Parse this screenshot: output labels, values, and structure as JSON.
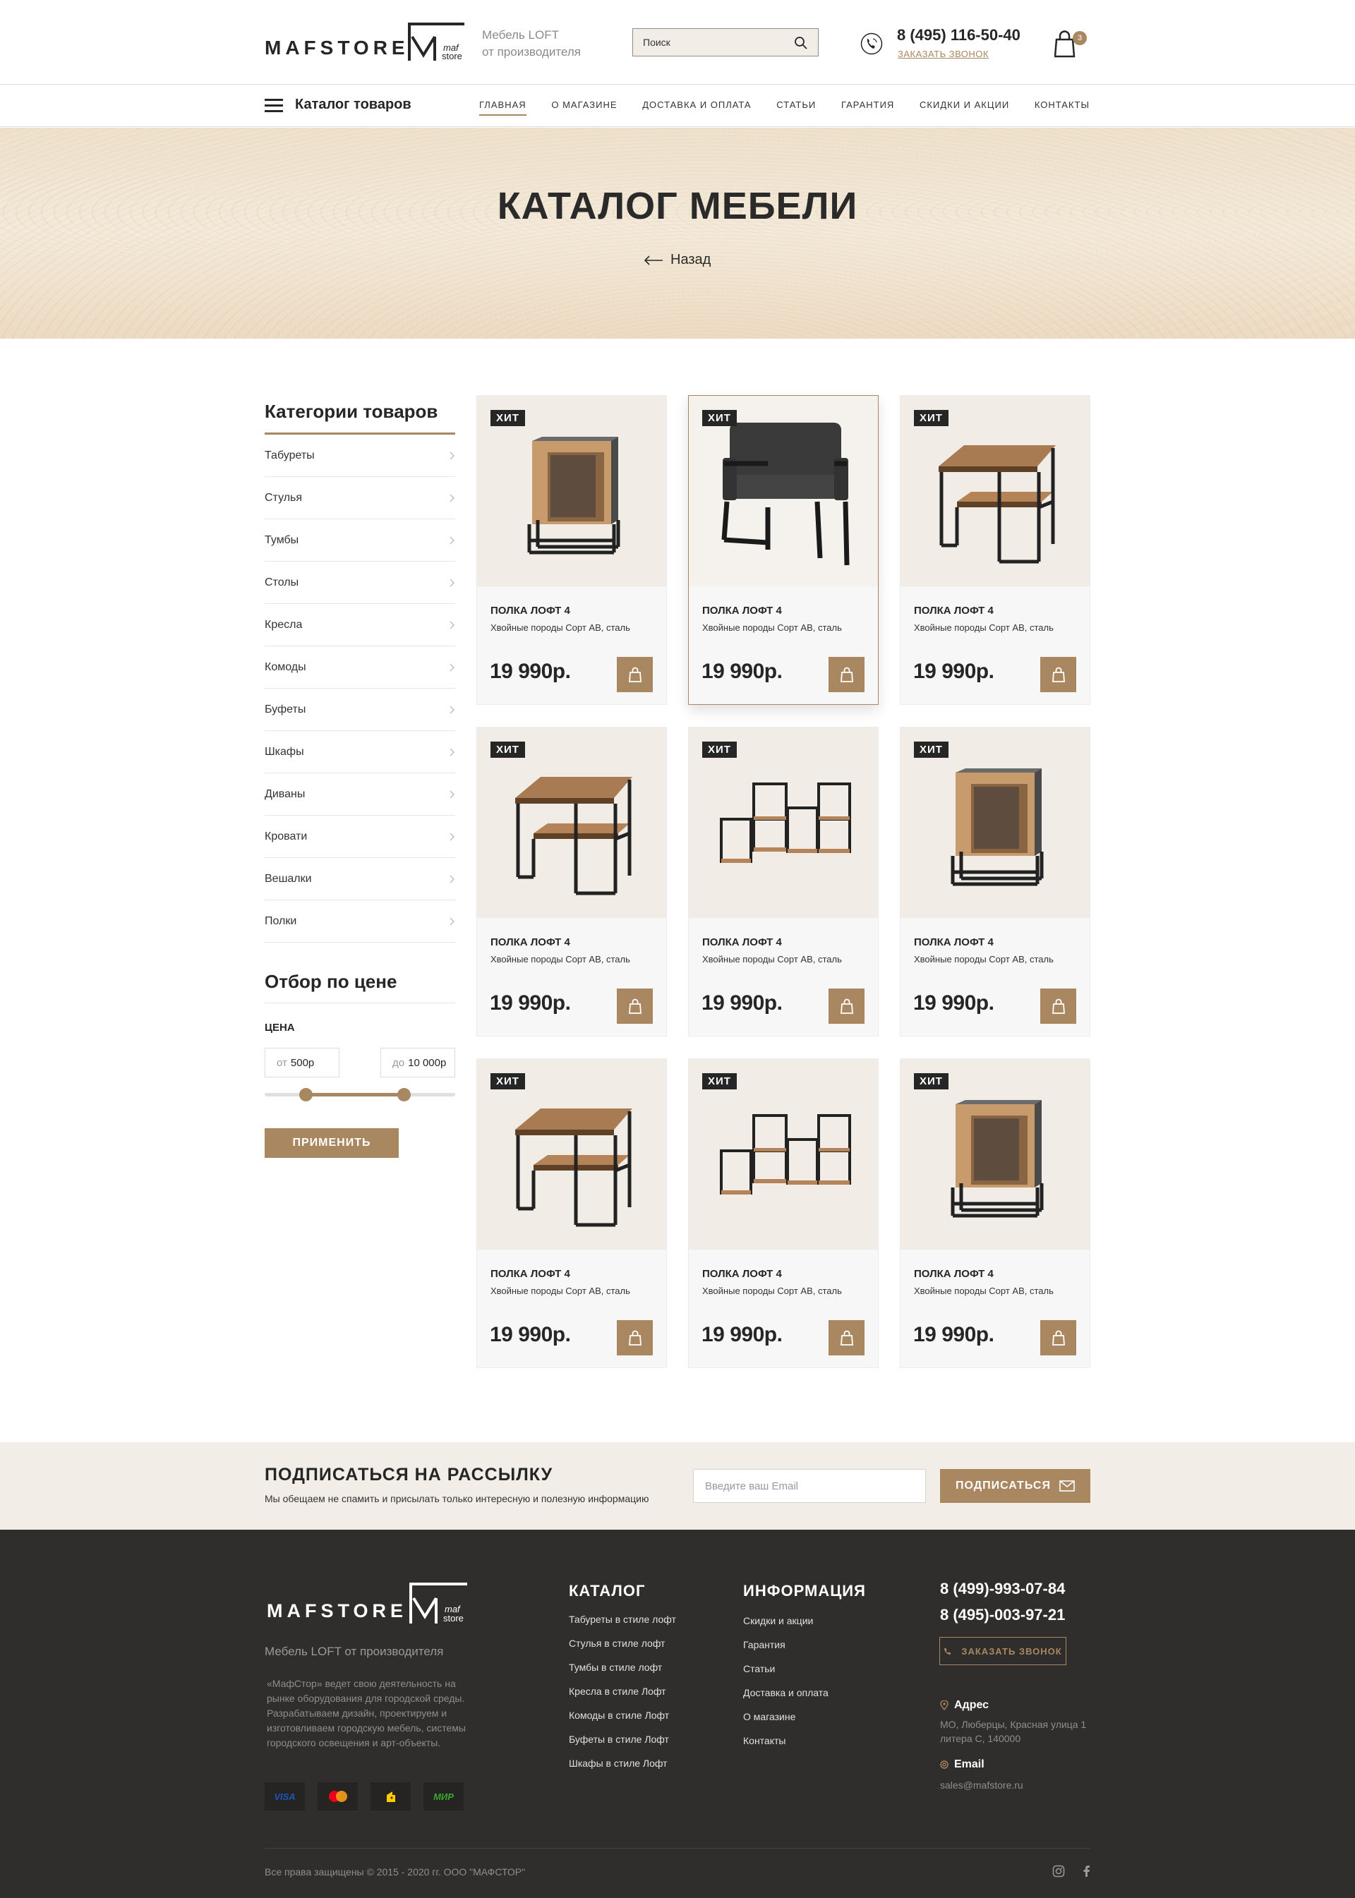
{
  "header": {
    "logo": "MAFSTORE",
    "logo_mark_top": "maf",
    "logo_mark_bottom": "store",
    "tagline_line1": "Мебель LOFT",
    "tagline_line2": "от производителя",
    "search_placeholder": "Поиск",
    "phone": "8 (495) 116-50-40",
    "callback": "ЗАКАЗАТЬ ЗВОНОК",
    "cart_count": "3"
  },
  "nav": {
    "catalog": "Каталог товаров",
    "items": [
      "ГЛАВНАЯ",
      "О МАГАЗИНЕ",
      "ДОСТАВКА И ОПЛАТА",
      "СТАТЬИ",
      "ГАРАНТИЯ",
      "СКИДКИ И АКЦИИ",
      "КОНТАКТЫ"
    ]
  },
  "hero": {
    "title": "КАТАЛОГ МЕБЕЛИ",
    "back": "Назад"
  },
  "sidebar": {
    "categories_title": "Категории товаров",
    "categories": [
      "Табуреты",
      "Стулья",
      "Тумбы",
      "Столы",
      "Кресла",
      "Комоды",
      "Буфеты",
      "Шкафы",
      "Диваны",
      "Кровати",
      "Вешалки",
      "Полки"
    ],
    "price_title": "Отбор по цене",
    "price_label": "ЦЕНА",
    "from_prefix": "от",
    "from_value": "500р",
    "to_prefix": "до",
    "to_value": "10 000р",
    "apply": "ПРИМЕНИТЬ"
  },
  "products": [
    {
      "badge": "ХИТ",
      "name": "ПОЛКА ЛОФТ 4",
      "desc": "Хвойные породы Сорт АВ, сталь",
      "price": "19 990р.",
      "image": "cube-shelf"
    },
    {
      "badge": "ХИТ",
      "name": "ПОЛКА ЛОФТ 4",
      "desc": "Хвойные породы Сорт АВ, сталь",
      "price": "19 990р.",
      "image": "armchair"
    },
    {
      "badge": "ХИТ",
      "name": "ПОЛКА ЛОФТ 4",
      "desc": "Хвойные породы Сорт АВ, сталь",
      "price": "19 990р.",
      "image": "side-table"
    },
    {
      "badge": "ХИТ",
      "name": "ПОЛКА ЛОФТ 4",
      "desc": "Хвойные породы Сорт АВ, сталь",
      "price": "19 990р.",
      "image": "side-table"
    },
    {
      "badge": "ХИТ",
      "name": "ПОЛКА ЛОФТ 4",
      "desc": "Хвойные породы Сорт АВ, сталь",
      "price": "19 990р.",
      "image": "cube-rack"
    },
    {
      "badge": "ХИТ",
      "name": "ПОЛКА ЛОФТ 4",
      "desc": "Хвойные породы Сорт АВ, сталь",
      "price": "19 990р.",
      "image": "cube-shelf"
    },
    {
      "badge": "ХИТ",
      "name": "ПОЛКА ЛОФТ 4",
      "desc": "Хвойные породы Сорт АВ, сталь",
      "price": "19 990р.",
      "image": "side-table"
    },
    {
      "badge": "ХИТ",
      "name": "ПОЛКА ЛОФТ 4",
      "desc": "Хвойные породы Сорт АВ, сталь",
      "price": "19 990р.",
      "image": "cube-rack"
    },
    {
      "badge": "ХИТ",
      "name": "ПОЛКА ЛОФТ 4",
      "desc": "Хвойные породы Сорт АВ, сталь",
      "price": "19 990р.",
      "image": "cube-shelf"
    }
  ],
  "subscribe": {
    "title": "ПОДПИСАТЬСЯ НА РАССЫЛКУ",
    "text": "Мы обещаем не спамить и присылать только интересную и полезную информацию",
    "placeholder": "Введите ваш Email",
    "button": "ПОДПИСАТЬСЯ"
  },
  "footer": {
    "logo": "MAFSTORE",
    "logo_mark_top": "maf",
    "logo_mark_bottom": "store",
    "tagline": "Мебель LOFT от производителя",
    "about": "«МафСтор» ведет свою деятельность на рынке оборудования для городской среды. Разрабатываем дизайн, проектируем и изготовливаем городскую мебель, системы городского освещения и арт-объекты.",
    "payments": [
      "VISA",
      "mastercard",
      "yandex-money",
      "МИР"
    ],
    "catalog_title": "КАТАЛОГ",
    "catalog_links": [
      "Табуреты в стиле лофт",
      "Стулья в стиле лофт",
      "Тумбы в стиле лофт",
      "Кресла в стиле Лофт",
      "Комоды в стиле Лофт",
      "Буфеты в стиле Лофт",
      "Шкафы в стиле Лофт"
    ],
    "info_title": "ИНФОРМАЦИЯ",
    "info_links": [
      "Скидки и акции",
      "Гарантия",
      "Статьи",
      "Доставка и оплата",
      "О магазине",
      "Контакты"
    ],
    "phone1": "8 (499)-993-07-84",
    "phone2": "8 (495)-003-97-21",
    "callback": "ЗАКАЗАТЬ ЗВОНОК",
    "address_label": "Адрес",
    "address": "МО, Люберцы, Красная улица 1 литера С, 140000",
    "email_label": "Email",
    "email": "sales@mafstore.ru",
    "copyright": "Все права защищены © 2015 - 2020 гг. ООО \"МАФСТОР\"",
    "social": [
      "instagram-icon",
      "facebook-icon"
    ]
  },
  "colors": {
    "accent": "#a98760",
    "dark": "#2f2e2d",
    "beige": "#f2ede6"
  }
}
